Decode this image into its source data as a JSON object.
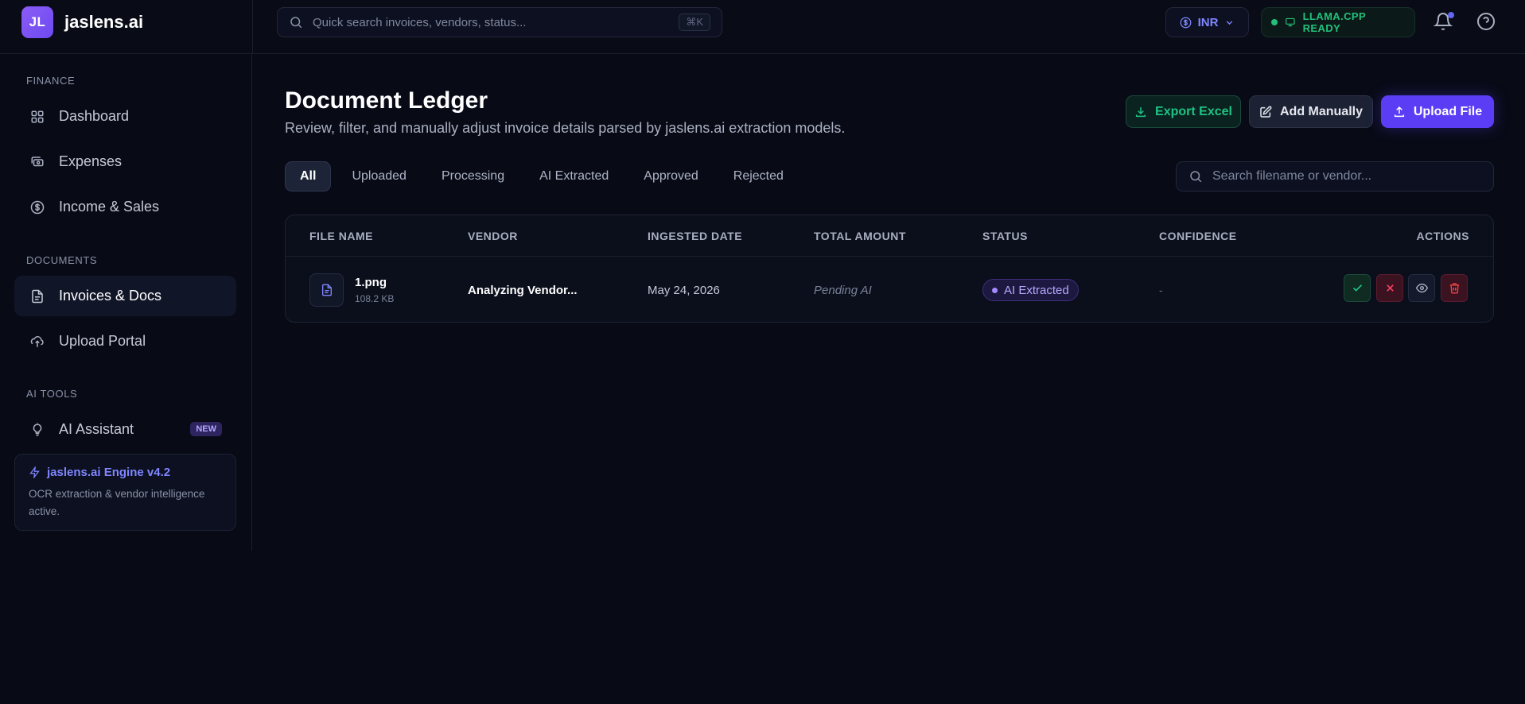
{
  "brand": {
    "logo_text": "JL",
    "name": "jaslens.ai"
  },
  "topbar": {
    "search_placeholder": "Quick search invoices, vendors, status...",
    "search_shortcut": "⌘K",
    "currency": "INR",
    "model_status": "LLAMA.CPP READY",
    "icons": [
      "search-icon",
      "dollar-icon",
      "chevron-down-icon",
      "monitor-icon",
      "bell-icon",
      "help-icon"
    ],
    "colors": {
      "accent": "#6366f1",
      "ready": "#22c07a"
    }
  },
  "sidebar": {
    "sections": [
      {
        "label": "FINANCE",
        "items": [
          {
            "label": "Dashboard",
            "icon": "grid-icon"
          },
          {
            "label": "Expenses",
            "icon": "cards-icon"
          },
          {
            "label": "Income & Sales",
            "icon": "dollar-circle-icon"
          }
        ]
      },
      {
        "label": "DOCUMENTS",
        "items": [
          {
            "label": "Invoices & Docs",
            "icon": "file-icon",
            "active": true
          },
          {
            "label": "Upload Portal",
            "icon": "cloud-upload-icon"
          }
        ]
      },
      {
        "label": "AI TOOLS",
        "items": [
          {
            "label": "AI Assistant",
            "icon": "bulb-icon",
            "badge": "NEW"
          }
        ]
      }
    ],
    "engine": {
      "title": "jaslens.ai Engine v4.2",
      "description": "OCR extraction & vendor intelligence active."
    }
  },
  "main": {
    "title": "Document Ledger",
    "subtitle": "Review, filter, and manually adjust invoice details parsed by jaslens.ai extraction models.",
    "buttons": {
      "export": "Export Excel",
      "add_manual": "Add Manually",
      "upload": "Upload File"
    },
    "tabs": [
      "All",
      "Uploaded",
      "Processing",
      "AI Extracted",
      "Approved",
      "Rejected"
    ],
    "active_tab": "All",
    "filter_placeholder": "Search filename or vendor...",
    "table": {
      "columns": [
        "FILE NAME",
        "VENDOR",
        "INGESTED DATE",
        "TOTAL AMOUNT",
        "STATUS",
        "CONFIDENCE",
        "ACTIONS"
      ],
      "rows": [
        {
          "file_name": "1.png",
          "file_size": "108.2 KB",
          "vendor": "Analyzing Vendor...",
          "date": "May 24, 2026",
          "amount": "Pending AI",
          "status": "AI Extracted",
          "confidence": "-",
          "actions": [
            "approve-icon",
            "reject-icon",
            "view-icon",
            "delete-icon"
          ]
        }
      ]
    },
    "colors": {
      "primary": "#5b3df5",
      "success": "#1fc383",
      "danger": "#ef4444",
      "status_purple": "#b6a8ff"
    }
  }
}
